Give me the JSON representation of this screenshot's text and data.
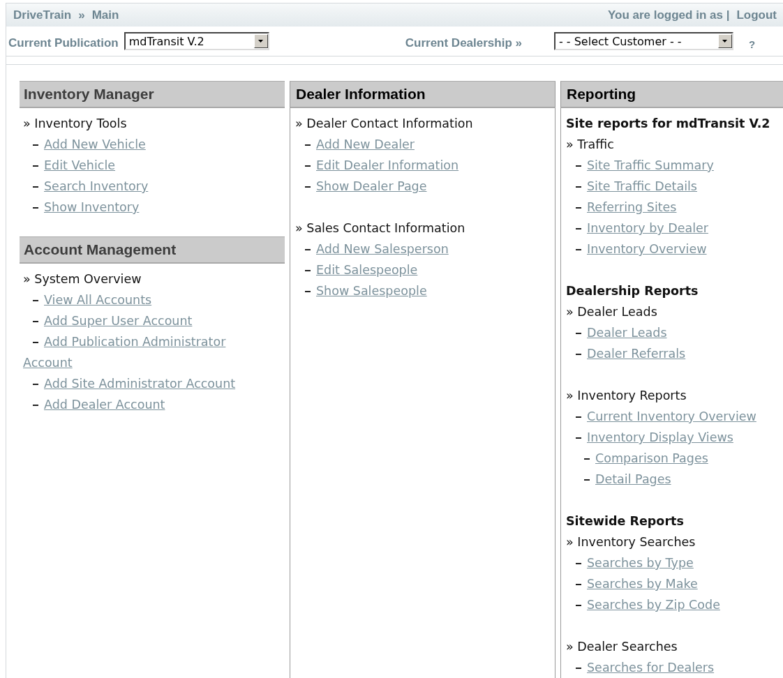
{
  "top_bar": {
    "breadcrumb": [
      "DriveTrain",
      "Main"
    ],
    "separator": "»",
    "login_text": "You are logged in as |",
    "logout": "Logout"
  },
  "selectors": {
    "publication_label": "Current Publication",
    "publication_value": "mdTransit V.2",
    "dealership_label": "Current Dealership »",
    "customer_value": "- - Select Customer - -",
    "help": "?"
  },
  "columns": [
    {
      "kind": "plain",
      "panels": [
        {
          "title": "Inventory Manager",
          "groups": [
            {
              "items": [
                {
                  "kind": "category",
                  "text": "» Inventory Tools"
                },
                {
                  "kind": "link",
                  "text": "Add New Vehicle"
                },
                {
                  "kind": "link",
                  "text": "Edit Vehicle"
                },
                {
                  "kind": "link",
                  "text": "Search Inventory"
                },
                {
                  "kind": "link",
                  "text": "Show Inventory"
                }
              ]
            }
          ]
        },
        {
          "title": "Account Management",
          "groups": [
            {
              "items": [
                {
                  "kind": "category",
                  "text": "» System Overview"
                },
                {
                  "kind": "link",
                  "text": "View All Accounts"
                },
                {
                  "kind": "link",
                  "text": "Add Super User Account"
                },
                {
                  "kind": "link",
                  "text": "Add Publication Administrator Account"
                },
                {
                  "kind": "link",
                  "text": "Add Site Administrator Account"
                },
                {
                  "kind": "link",
                  "text": "Add Dealer Account"
                }
              ]
            }
          ]
        }
      ]
    },
    {
      "kind": "boxed",
      "panels": [
        {
          "title": "Dealer Information",
          "groups": [
            {
              "items": [
                {
                  "kind": "category",
                  "text": "» Dealer Contact Information"
                },
                {
                  "kind": "link",
                  "text": "Add New Dealer"
                },
                {
                  "kind": "link",
                  "text": "Edit Dealer Information"
                },
                {
                  "kind": "link",
                  "text": "Show Dealer Page"
                }
              ]
            },
            {
              "items": [
                {
                  "kind": "category",
                  "text": "» Sales Contact Information"
                },
                {
                  "kind": "link",
                  "text": "Add New Salesperson"
                },
                {
                  "kind": "link",
                  "text": "Edit Salespeople"
                },
                {
                  "kind": "link",
                  "text": "Show Salespeople"
                }
              ]
            }
          ]
        }
      ]
    },
    {
      "kind": "boxed",
      "panels": [
        {
          "title": "Reporting",
          "groups": [
            {
              "heading": "Site reports for mdTransit V.2",
              "items": [
                {
                  "kind": "category",
                  "text": "» Traffic"
                },
                {
                  "kind": "link",
                  "text": "Site Traffic Summary"
                },
                {
                  "kind": "link",
                  "text": "Site Traffic Details"
                },
                {
                  "kind": "link",
                  "text": "Referring Sites"
                },
                {
                  "kind": "link",
                  "text": "Inventory by Dealer"
                },
                {
                  "kind": "link",
                  "text": "Inventory Overview"
                }
              ]
            },
            {
              "heading": "Dealership Reports",
              "items": [
                {
                  "kind": "category",
                  "text": "» Dealer Leads"
                },
                {
                  "kind": "link",
                  "text": "Dealer Leads"
                },
                {
                  "kind": "link",
                  "text": "Dealer Referrals"
                }
              ]
            },
            {
              "items": [
                {
                  "kind": "category",
                  "text": "» Inventory Reports"
                },
                {
                  "kind": "link",
                  "text": "Current Inventory Overview"
                },
                {
                  "kind": "link",
                  "text": "Inventory Display Views",
                  "children": [
                    {
                      "kind": "link",
                      "text": "Comparison Pages"
                    },
                    {
                      "kind": "link",
                      "text": "Detail Pages"
                    }
                  ]
                }
              ]
            },
            {
              "heading": "Sitewide Reports",
              "items": [
                {
                  "kind": "category",
                  "text": "» Inventory Searches"
                },
                {
                  "kind": "link",
                  "text": "Searches by Type"
                },
                {
                  "kind": "link",
                  "text": "Searches by Make"
                },
                {
                  "kind": "link",
                  "text": "Searches by Zip Code"
                }
              ]
            },
            {
              "items": [
                {
                  "kind": "category",
                  "text": "» Dealer Searches"
                },
                {
                  "kind": "link",
                  "text": "Searches for Dealers"
                }
              ]
            }
          ]
        }
      ]
    }
  ]
}
